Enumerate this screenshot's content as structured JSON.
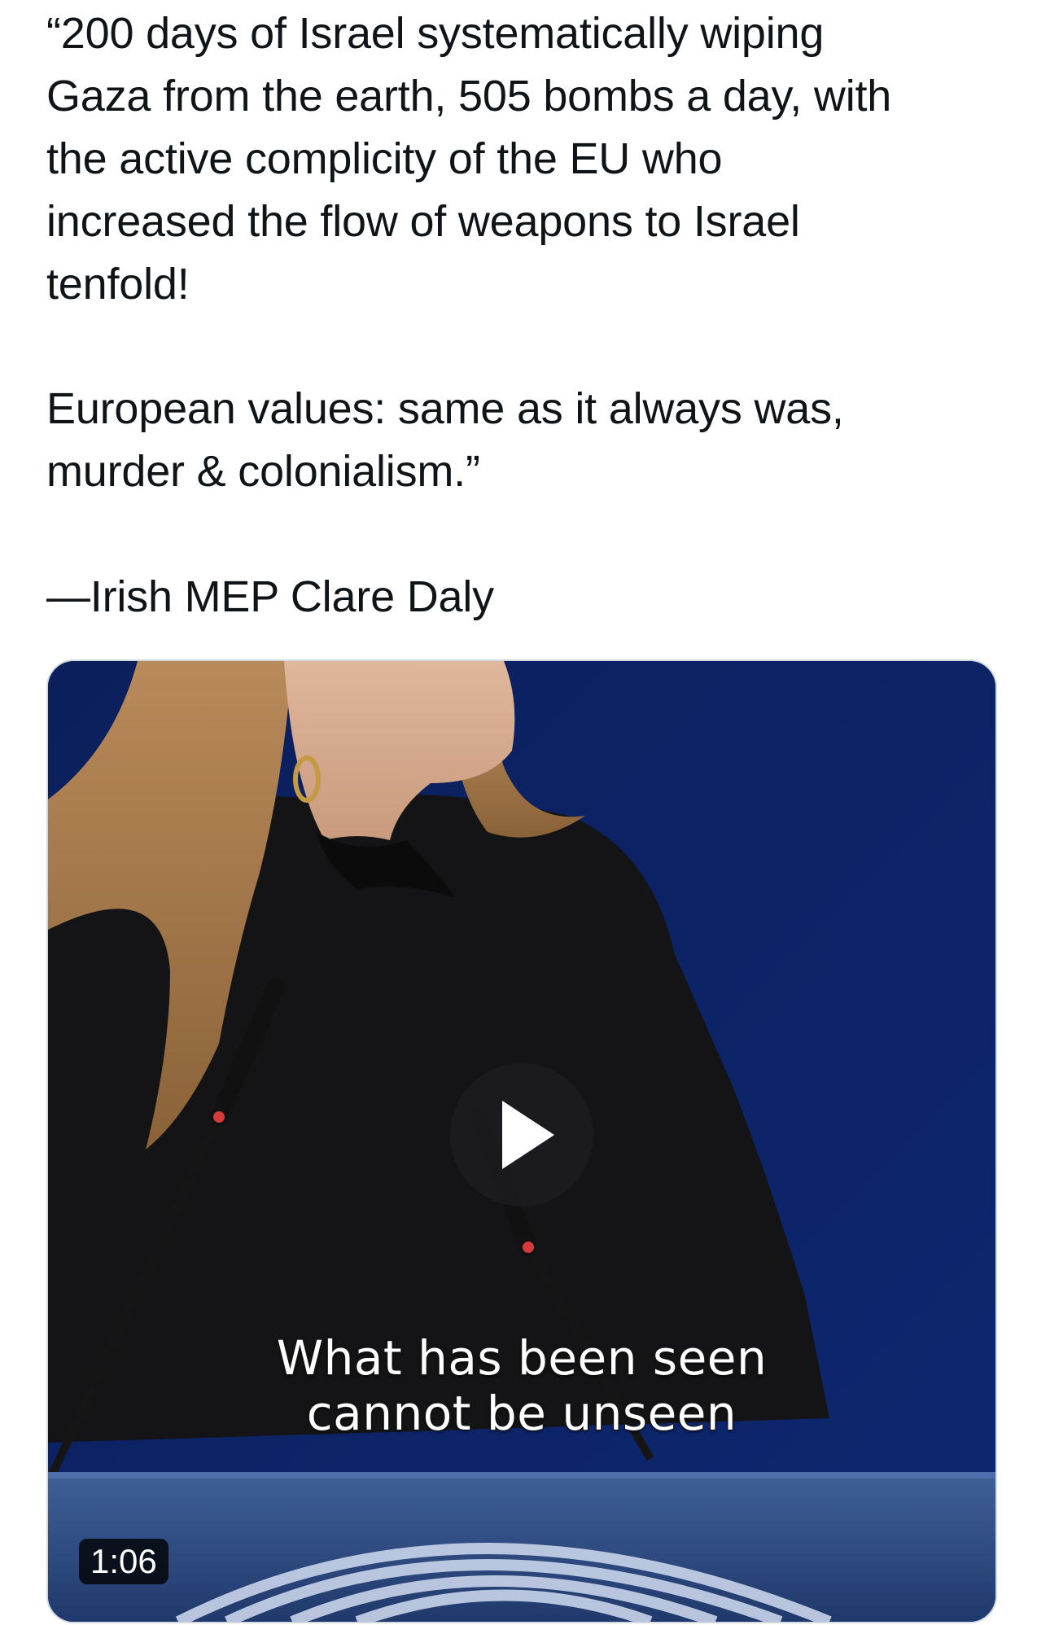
{
  "tweet": {
    "paragraphs": [
      "“200 days of Israel systematically wiping\nGaza from the earth, 505 bombs a day, with\nthe active complicity of the EU who\nincreased the flow of weapons to Israel\ntenfold!",
      "European values: same as it always was,\nmurder & colonialism.”",
      "—Irish MEP Clare Daly"
    ]
  },
  "video": {
    "caption_line1": "What has been seen",
    "caption_line2": "cannot be unseen",
    "duration": "1:06",
    "play_icon": "play-icon",
    "colors": {
      "background": "#0d2263",
      "card_border": "#cfd9de",
      "text": "#0f1419"
    }
  }
}
